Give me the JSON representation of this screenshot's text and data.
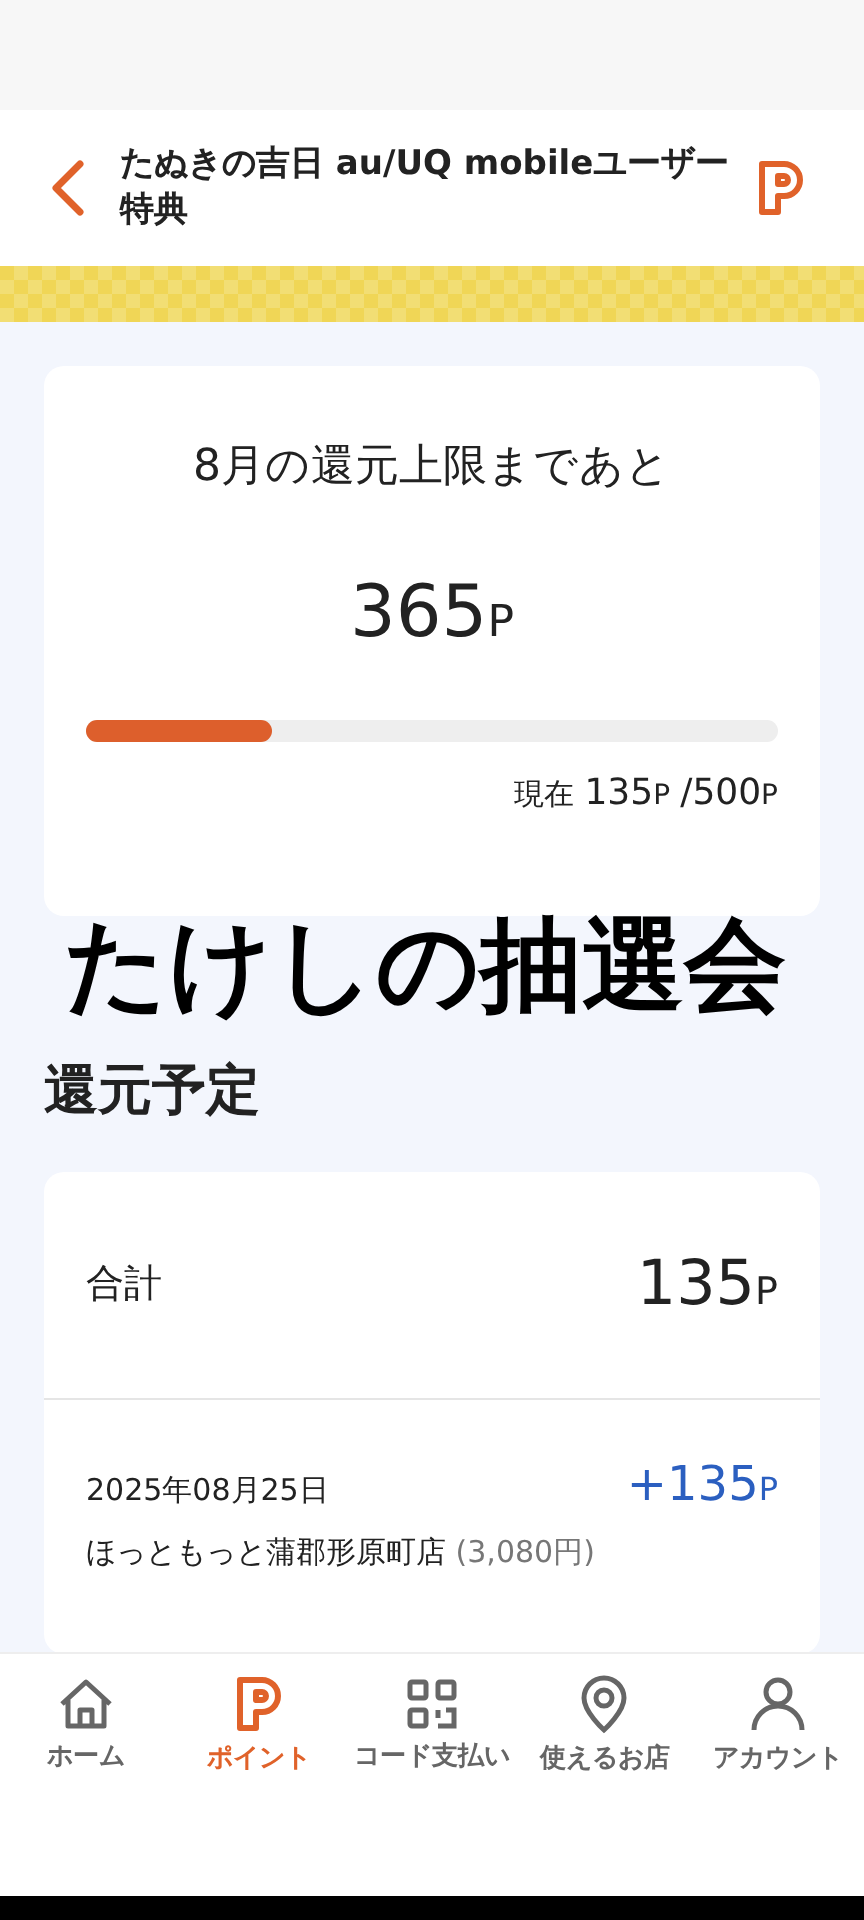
{
  "header": {
    "title": "たぬきの吉日 au/UQ mobileユーザー特典"
  },
  "limit_card": {
    "heading": "8月の還元上限まであと",
    "remaining": "365",
    "remaining_unit": "P",
    "level": 0.27,
    "current_label": "現在",
    "current": "135",
    "current_unit": "P",
    "max": "/500",
    "max_unit": "P"
  },
  "overlay_caption": "たけしの抽選会",
  "section_title": "還元予定",
  "total": {
    "label": "合計",
    "amount": "135",
    "unit": "P"
  },
  "entries": [
    {
      "date": "2025年08月25日",
      "store": "ほっともっと蒲郡形原町店",
      "price": "(3,080円)",
      "amount": "+135",
      "unit": "P"
    }
  ],
  "nav": [
    {
      "label": "ホーム",
      "kind": "home",
      "selected": false
    },
    {
      "label": "ポイント",
      "kind": "point",
      "selected": true
    },
    {
      "label": "コード支払い",
      "kind": "code",
      "selected": false
    },
    {
      "label": "使えるお店",
      "kind": "store",
      "selected": false
    },
    {
      "label": "アカウント",
      "kind": "account",
      "selected": false
    }
  ]
}
